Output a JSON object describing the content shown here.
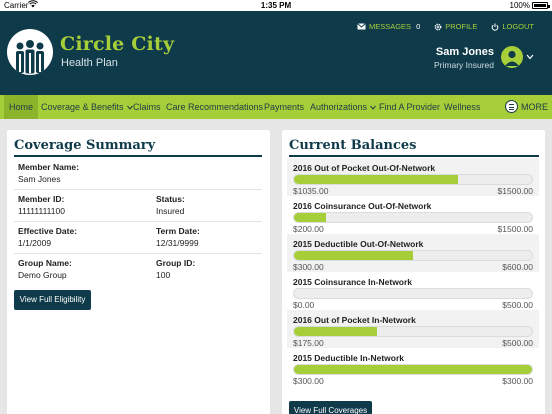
{
  "status_bar": {
    "carrier": "Carrier",
    "time": "1:35 PM",
    "battery": "100%"
  },
  "brand": {
    "name": "Circle City",
    "tagline": "Health Plan",
    "accent": "#a6ce39",
    "dark": "#0f3a4a"
  },
  "top_links": {
    "messages_label": "MESSAGES",
    "messages_count": "0",
    "profile_label": "PROFILE",
    "logout_label": "LOGOUT"
  },
  "user": {
    "name": "Sam Jones",
    "role": "Primary Insured"
  },
  "nav": {
    "items": [
      {
        "label": "Home",
        "active": true
      },
      {
        "label": "Coverage & Benefits",
        "dropdown": true
      },
      {
        "label": "Claims"
      },
      {
        "label": "Care Recommendations"
      },
      {
        "label": "Payments"
      },
      {
        "label": "Authorizations",
        "dropdown": true
      },
      {
        "label": "Find A Provider"
      },
      {
        "label": "Wellness"
      }
    ],
    "more_label": "MORE"
  },
  "coverage": {
    "title": "Coverage Summary",
    "member_name_label": "Member Name:",
    "member_name": "Sam Jones",
    "member_id_label": "Member ID:",
    "member_id": "11111111100",
    "status_label": "Status:",
    "status": "Insured",
    "effective_label": "Effective Date:",
    "effective": "1/1/2009",
    "term_label": "Term Date:",
    "term": "12/31/9999",
    "group_name_label": "Group Name:",
    "group_name": "Demo Group",
    "group_id_label": "Group ID:",
    "group_id": "100",
    "button": "View Full Eligibility"
  },
  "balances": {
    "title": "Current Balances",
    "items": [
      {
        "label": "2016 Out of Pocket Out-Of-Network",
        "used": "$1035.00",
        "max": "$1500.00",
        "fraction": 0.69
      },
      {
        "label": "2016 Coinsurance Out-Of-Network",
        "used": "$200.00",
        "max": "$1500.00",
        "fraction": 0.133
      },
      {
        "label": "2015 Deductible Out-Of-Network",
        "used": "$300.00",
        "max": "$600.00",
        "fraction": 0.5
      },
      {
        "label": "2015 Coinsurance In-Network",
        "used": "$0.00",
        "max": "$500.00",
        "fraction": 0.0
      },
      {
        "label": "2016 Out of Pocket In-Network",
        "used": "$175.00",
        "max": "$500.00",
        "fraction": 0.35
      },
      {
        "label": "2015 Deductible In-Network",
        "used": "$300.00",
        "max": "$300.00",
        "fraction": 1.0
      }
    ],
    "button": "View Full Coverages"
  }
}
